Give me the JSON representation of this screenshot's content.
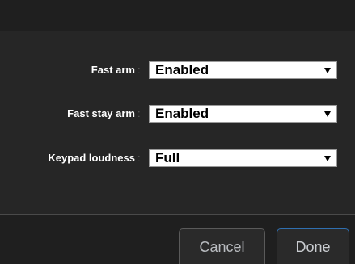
{
  "settings": [
    {
      "label": "Fast arm",
      "value": "Enabled"
    },
    {
      "label": "Fast stay arm",
      "value": "Enabled"
    },
    {
      "label": "Keypad loudness",
      "value": "Full"
    }
  ],
  "separator": ":",
  "footer": {
    "cancel_label": "Cancel",
    "done_label": "Done"
  },
  "colors": {
    "background": "#262626",
    "header_footer": "#1f1f1f",
    "done_border": "#2f6fb0"
  }
}
